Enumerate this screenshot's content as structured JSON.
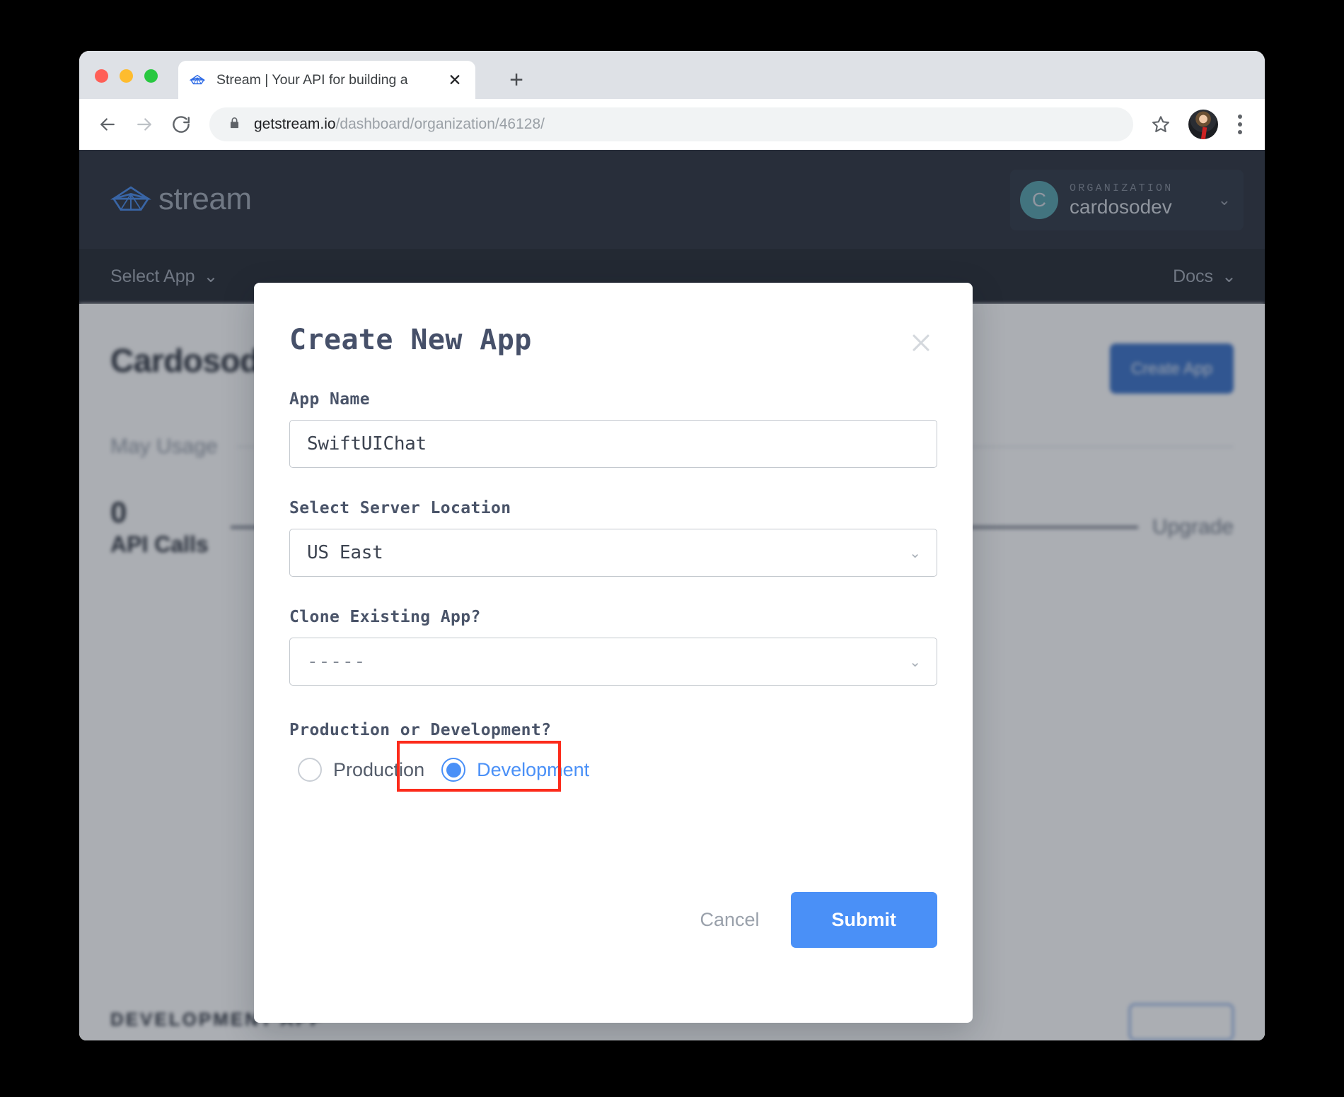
{
  "browser": {
    "tab": {
      "title": "Stream | Your API for building a",
      "favicon_icon": "stream-boat-icon",
      "close_icon": "close-icon"
    },
    "new_tab_icon": "plus-icon",
    "back_icon": "arrow-left-icon",
    "forward_icon": "arrow-right-icon",
    "reload_icon": "reload-icon",
    "lock_icon": "lock-icon",
    "url_domain": "getstream.io",
    "url_path": "/dashboard/organization/46128/",
    "star_icon": "star-icon",
    "avatar_name": "profile-avatar",
    "menu_icon": "three-dot-menu-icon"
  },
  "app_header": {
    "brand": "stream",
    "brand_icon": "stream-boat-icon",
    "org_initial": "C",
    "org_label": "ORGANIZATION",
    "org_name": "cardosodev",
    "org_chevron_icon": "chevron-down-icon"
  },
  "subnav": {
    "select_app": "Select App",
    "docs": "Docs",
    "chevron_icon": "chevron-down-icon"
  },
  "page": {
    "title": "Cardosodev Overview",
    "create_app_button": "Create App",
    "usage_title": "May Usage",
    "usage_value": "0",
    "usage_unit": "API Calls",
    "upgrade_link": "Upgrade",
    "dev_app_label": "DEVELOPMENT APP"
  },
  "modal": {
    "title": "Create New App",
    "close_icon": "close-icon",
    "app_name": {
      "label": "App Name",
      "value": "SwiftUIChat"
    },
    "server_location": {
      "label": "Select Server Location",
      "value": "US East",
      "chevron_icon": "chevron-down-icon"
    },
    "clone_app": {
      "label": "Clone Existing App?",
      "value": "-----",
      "chevron_icon": "chevron-down-icon"
    },
    "environment": {
      "label": "Production or Development?",
      "options": [
        {
          "label": "Production",
          "checked": false
        },
        {
          "label": "Development",
          "checked": true
        }
      ]
    },
    "cancel_label": "Cancel",
    "submit_label": "Submit"
  },
  "colors": {
    "accent_blue": "#4a90f7",
    "brand_blue": "#2d68c4",
    "annotation_red": "#fc2b1b",
    "header_dark": "#1e2430",
    "subnav_dark": "#151a24",
    "org_avatar_teal": "#4a9ca5"
  }
}
